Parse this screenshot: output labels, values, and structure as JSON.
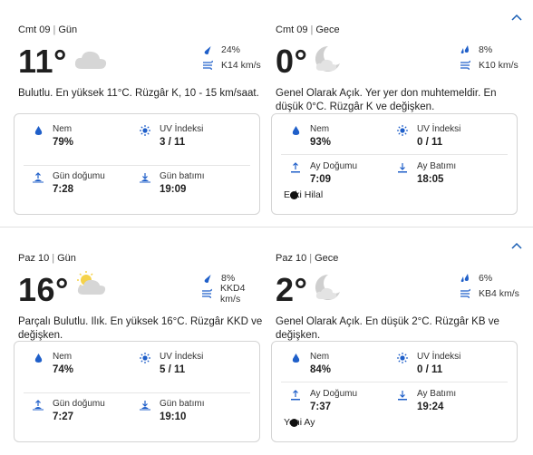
{
  "colors": {
    "accent": "#1a5fb4",
    "icon_blue": "#1f5fc9",
    "border": "#d4d4d4",
    "text": "#1f1f1f"
  },
  "days": [
    {
      "day": {
        "date": "Cmt 09",
        "period": "Gün",
        "temp": "11°",
        "icon": "cloud-icon",
        "precip": "24%",
        "wind": "K14 km/s",
        "description": "Bulutlu. En yüksek 11°C. Rüzgâr K, 10 - 15 km/saat.",
        "humidity_label": "Nem",
        "humidity": "79%",
        "uv_label": "UV İndeksi",
        "uv": "3 / 11",
        "rise_label": "Gün doğumu",
        "rise": "7:28",
        "set_label": "Gün batımı",
        "set": "19:09"
      },
      "night": {
        "date": "Cmt 09",
        "period": "Gece",
        "temp": "0°",
        "icon": "moon-cloud-icon",
        "precip": "8%",
        "wind": "K10 km/s",
        "description": "Genel Olarak Açık. Yer yer don muhtemeldir. En düşük 0°C. Rüzgâr K ve değişken.",
        "humidity_label": "Nem",
        "humidity": "93%",
        "uv_label": "UV İndeksi",
        "uv": "0 / 11",
        "rise_label": "Ay Doğumu",
        "rise": "7:09",
        "set_label": "Ay Batımı",
        "set": "18:05",
        "moon_phase": "Eski Hilal"
      }
    },
    {
      "day": {
        "date": "Paz 10",
        "period": "Gün",
        "temp": "16°",
        "icon": "partly-cloudy-icon",
        "precip": "8%",
        "wind": "KKD4 km/s",
        "description": "Parçalı Bulutlu. Ilık. En yüksek 16°C. Rüzgâr KKD ve değişken.",
        "humidity_label": "Nem",
        "humidity": "74%",
        "uv_label": "UV İndeksi",
        "uv": "5 / 11",
        "rise_label": "Gün doğumu",
        "rise": "7:27",
        "set_label": "Gün batımı",
        "set": "19:10"
      },
      "night": {
        "date": "Paz 10",
        "period": "Gece",
        "temp": "2°",
        "icon": "moon-cloud-icon",
        "precip": "6%",
        "wind": "KB4 km/s",
        "description": "Genel Olarak Açık. En düşük 2°C. Rüzgâr KB ve değişken.",
        "humidity_label": "Nem",
        "humidity": "84%",
        "uv_label": "UV İndeksi",
        "uv": "0 / 11",
        "rise_label": "Ay Doğumu",
        "rise": "7:37",
        "set_label": "Ay Batımı",
        "set": "19:24",
        "moon_phase": "Yeni Ay"
      }
    }
  ]
}
